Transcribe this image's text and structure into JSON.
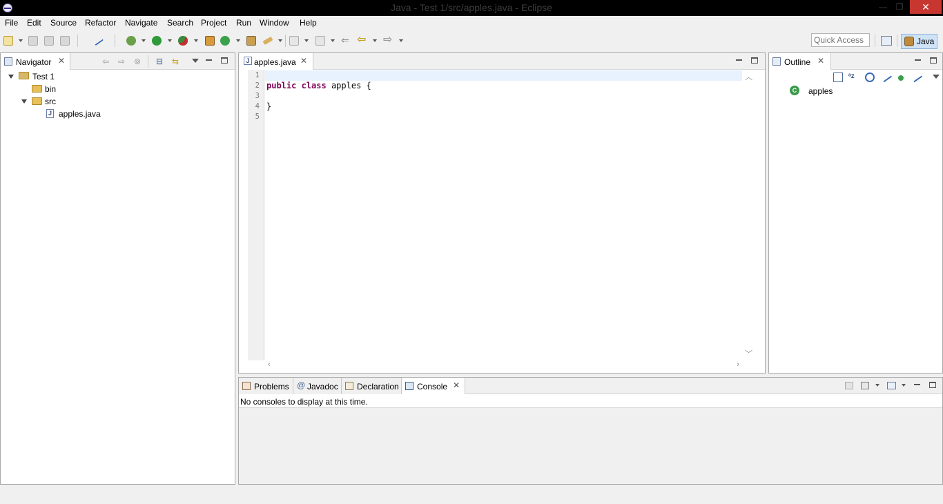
{
  "window": {
    "title": "Java - Test 1/src/apples.java - Eclipse",
    "minimize_glyph": "—",
    "restore_glyph": "❐",
    "close_glyph": "✕"
  },
  "menu": [
    "File",
    "Edit",
    "Source",
    "Refactor",
    "Navigate",
    "Search",
    "Project",
    "Run",
    "Window",
    "Help"
  ],
  "toolbar": {
    "quick_access_placeholder": "Quick Access",
    "perspective_label": "Java",
    "icons": [
      "new-wizard-icon",
      "save-icon",
      "save-all-icon",
      "print-icon",
      "skip-breakpoints-icon",
      "debug-icon",
      "run-icon",
      "coverage-icon",
      "new-java-package-icon",
      "new-java-class-icon",
      "open-type-icon",
      "search-icon",
      "next-annotation-icon",
      "previous-annotation-icon",
      "last-edit-location-icon",
      "back-icon",
      "forward-icon"
    ]
  },
  "navigator": {
    "tab_label": "Navigator",
    "tree": [
      {
        "label": "Test 1",
        "type": "project",
        "expanded": true,
        "depth": 0
      },
      {
        "label": "bin",
        "type": "folder",
        "expanded": false,
        "depth": 1
      },
      {
        "label": "src",
        "type": "folder",
        "expanded": true,
        "depth": 1
      },
      {
        "label": "apples.java",
        "type": "java-file",
        "depth": 2
      }
    ]
  },
  "editor": {
    "tab_label": "apples.java",
    "line_numbers": [
      "1",
      "2",
      "3",
      "4",
      "5"
    ],
    "code": {
      "line2_kw1": "public",
      "line2_kw2": "class",
      "line2_rest": " apples {",
      "line4": "}"
    }
  },
  "outline": {
    "tab_label": "Outline",
    "items": [
      {
        "label": "apples",
        "type": "class"
      }
    ]
  },
  "bottom": {
    "tabs": [
      {
        "label": "Problems",
        "active": false
      },
      {
        "label": "Javadoc",
        "active": false
      },
      {
        "label": "Declaration",
        "active": false
      },
      {
        "label": "Console",
        "active": true
      }
    ],
    "javadoc_glyph": "@",
    "console_message": "No consoles to display at this time."
  },
  "colors": {
    "keyword": "#7f0055",
    "current_line": "#e8f2fe",
    "close_button": "#c7372f",
    "perspective_active": "#cfe3f7"
  }
}
